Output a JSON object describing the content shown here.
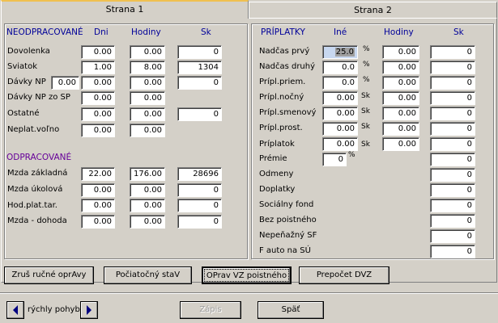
{
  "tabs": [
    "Strana 1",
    "Strana 2"
  ],
  "left": {
    "neo_header": "NEODPRACOVANÉ",
    "col_dni": "Dni",
    "col_hodiny": "Hodiny",
    "col_sk": "Sk",
    "rows": [
      {
        "label": "Dovolenka",
        "dni": "0.00",
        "hodiny": "0.00",
        "sk": "0"
      },
      {
        "label": "Sviatok",
        "dni": "1.00",
        "hodiny": "8.00",
        "sk": "1304"
      },
      {
        "label": "Dávky NP",
        "extra": "0.00",
        "dni": "0.00",
        "hodiny": "0.00",
        "sk": "0"
      },
      {
        "label": "Dávky NP zo SP",
        "dni": "0.00",
        "hodiny": "0.00"
      },
      {
        "label": "Ostatné",
        "dni": "0.00",
        "hodiny": "0.00",
        "sk": "0"
      },
      {
        "label": "Neplat.voľno",
        "dni": "0.00",
        "hodiny": "0.00"
      }
    ],
    "odp_header": "ODPRACOVANÉ",
    "odp_rows": [
      {
        "label": "Mzda základná",
        "dni": "22.00",
        "hodiny": "176.00",
        "sk": "28696"
      },
      {
        "label": "Mzda úkolová",
        "dni": "0.00",
        "hodiny": "0.00",
        "sk": "0"
      },
      {
        "label": "Hod.plat.tar.",
        "dni": "0.00",
        "hodiny": "0.00",
        "sk": "0"
      },
      {
        "label": "Mzda - dohoda",
        "dni": "0.00",
        "hodiny": "0.00",
        "sk": "0"
      }
    ]
  },
  "right": {
    "header": "PRÍPLATKY",
    "col_ine": "Iné",
    "col_hodiny": "Hodiny",
    "col_sk": "Sk",
    "rows": [
      {
        "label": "Nadčas prvý",
        "ine": "25.0",
        "unit": "%",
        "hodiny": "0.00",
        "sk": "0"
      },
      {
        "label": "Nadčas druhý",
        "ine": "0.0",
        "unit": "%",
        "hodiny": "0.00",
        "sk": "0"
      },
      {
        "label": "Prípl.priem.",
        "ine": "0.0",
        "unit": "%",
        "hodiny": "0.00",
        "sk": "0"
      },
      {
        "label": "Prípl.nočný",
        "ine": "0.00",
        "unit": "Sk",
        "hodiny": "0.00",
        "sk": "0"
      },
      {
        "label": "Prípl.smenový",
        "ine": "0.00",
        "unit": "Sk",
        "hodiny": "0.00",
        "sk": "0"
      },
      {
        "label": "Prípl.prost.",
        "ine": "0.00",
        "unit": "Sk",
        "hodiny": "0.00",
        "sk": "0"
      },
      {
        "label": "Príplatok",
        "ine": "0.00",
        "unit": "Sk",
        "hodiny": "0.00",
        "sk": "0"
      },
      {
        "label": "Prémie",
        "ine": "0",
        "unit": "%",
        "sk": "0"
      },
      {
        "label": "Odmeny",
        "sk": "0"
      },
      {
        "label": "Doplatky",
        "sk": "0"
      },
      {
        "label": "Sociálny fond",
        "sk": "0"
      },
      {
        "label": "Bez poistného",
        "sk": "0"
      },
      {
        "label": "Nepeňažný SF",
        "sk": "0"
      },
      {
        "label": "F auto na SÚ",
        "sk": "0"
      }
    ]
  },
  "buttons": {
    "zrus": "Zruš ručné oprAvy",
    "pociatocny": "Počiatočný staV",
    "oprav": "OPrav VZ poistného",
    "prepocet": "Prepočet DVZ",
    "zapis": "Zápis",
    "spat": "Späť"
  },
  "nav": {
    "label": "rýchly pohyb"
  }
}
